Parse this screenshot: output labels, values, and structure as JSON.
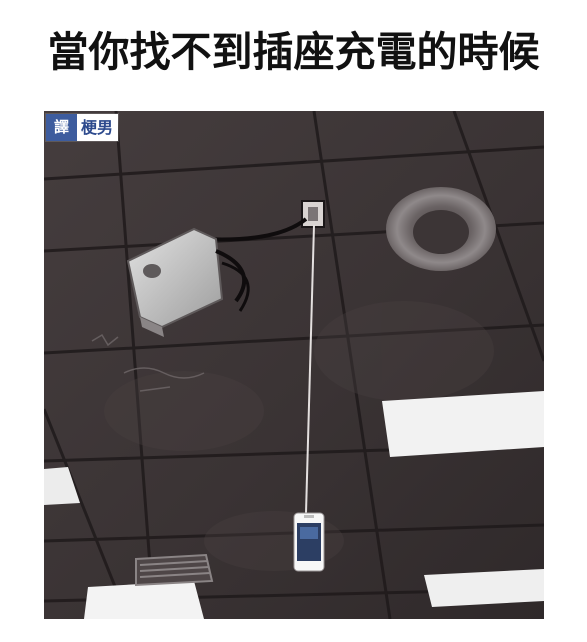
{
  "caption": {
    "text": "當你找不到插座充電的時候"
  },
  "photo": {
    "subject": "phone-hanging-from-ceiling-outlet",
    "colors": {
      "ceiling": "#3c3536",
      "ceiling_tile_light": "#51484a",
      "grid_line": "#1f1a1b",
      "light_panel": "#f3f3f3",
      "projector": "#bfbfbf"
    }
  },
  "watermark": {
    "badge": "譯",
    "text": "梗男",
    "colors": {
      "badge_bg": "#3d5c9e",
      "text_color": "#2d4a8d"
    }
  }
}
